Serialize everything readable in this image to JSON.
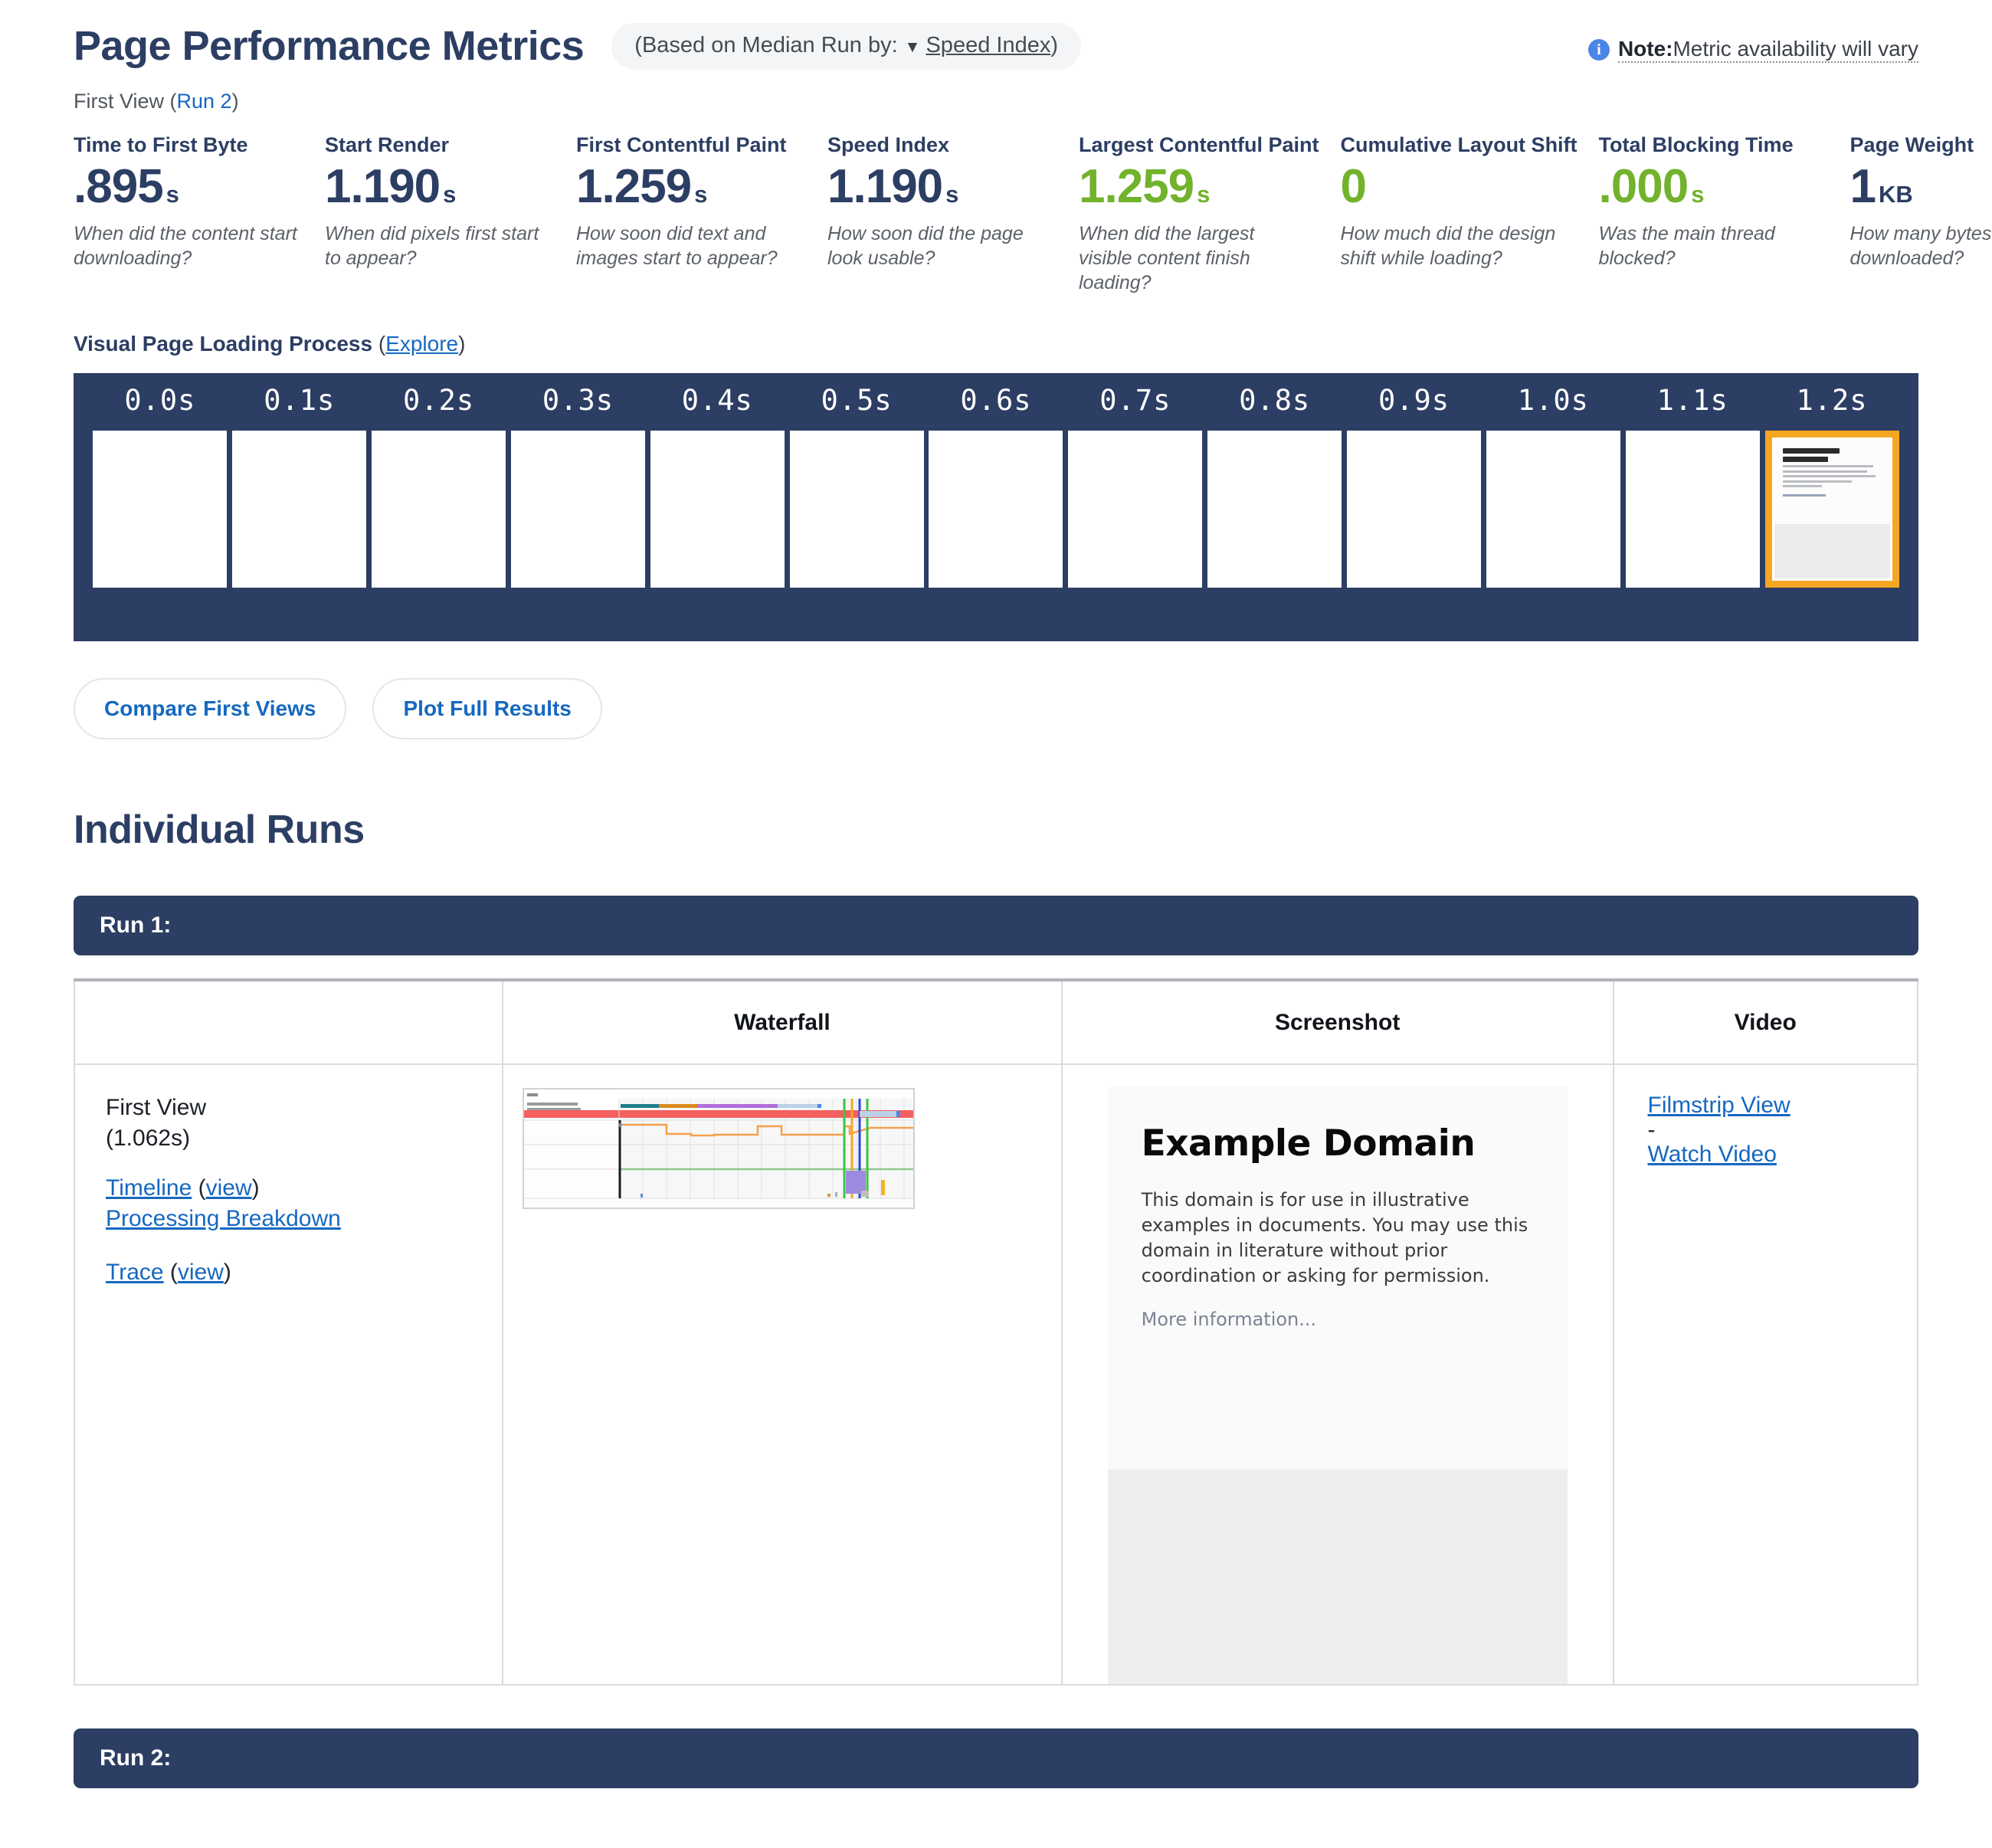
{
  "header": {
    "title": "Page Performance Metrics",
    "median_prefix": "(Based on Median Run by:",
    "median_caret": "▼",
    "median_selected": "Speed Index",
    "median_suffix": ")",
    "note_icon": "info-icon",
    "note_bold": "Note:",
    "note_text": " Metric availability will vary",
    "first_view_prefix": "First View (",
    "first_view_run": "Run 2",
    "first_view_suffix": ")"
  },
  "colors": {
    "navy": "#2c3e63",
    "green": "#72b22c",
    "link": "#1668c1",
    "highlight": "#f5a623"
  },
  "metrics": [
    {
      "label": "Time to First Byte",
      "value": ".895",
      "unit": "s",
      "color": "navy",
      "desc": "When did the content start downloading?"
    },
    {
      "label": "Start Render",
      "value": "1.190",
      "unit": "s",
      "color": "navy",
      "desc": "When did pixels first start to appear?"
    },
    {
      "label": "First Contentful Paint",
      "value": "1.259",
      "unit": "s",
      "color": "navy",
      "desc": "How soon did text and images start to appear?"
    },
    {
      "label": "Speed Index",
      "value": "1.190",
      "unit": "s",
      "color": "navy",
      "desc": "How soon did the page look usable?"
    },
    {
      "label": "Largest Contentful Paint",
      "value": "1.259",
      "unit": "s",
      "color": "green",
      "desc": "When did the largest visible content finish loading?"
    },
    {
      "label": "Cumulative Layout Shift",
      "value": "0",
      "unit": "",
      "color": "green",
      "desc": "How much did the design shift while loading?"
    },
    {
      "label": "Total Blocking Time",
      "value": ".000",
      "unit": "s",
      "color": "green",
      "desc": "Was the main thread blocked?"
    },
    {
      "label": "Page Weight",
      "value": "1",
      "unit": "KB",
      "color": "navy",
      "desc": "How many bytes downloaded?"
    }
  ],
  "visual_loading": {
    "title": "Visual Page Loading Process",
    "explore_label": "Explore",
    "frames": [
      {
        "time": "0.0s",
        "highlighted": false
      },
      {
        "time": "0.1s",
        "highlighted": false
      },
      {
        "time": "0.2s",
        "highlighted": false
      },
      {
        "time": "0.3s",
        "highlighted": false
      },
      {
        "time": "0.4s",
        "highlighted": false
      },
      {
        "time": "0.5s",
        "highlighted": false
      },
      {
        "time": "0.6s",
        "highlighted": false
      },
      {
        "time": "0.7s",
        "highlighted": false
      },
      {
        "time": "0.8s",
        "highlighted": false
      },
      {
        "time": "0.9s",
        "highlighted": false
      },
      {
        "time": "1.0s",
        "highlighted": false
      },
      {
        "time": "1.1s",
        "highlighted": false
      },
      {
        "time": "1.2s",
        "highlighted": true
      }
    ]
  },
  "buttons": {
    "compare_first_views": "Compare First Views",
    "plot_full_results": "Plot Full Results"
  },
  "individual_runs": {
    "section_title": "Individual Runs",
    "run1_label": "Run 1:",
    "run2_label": "Run 2:",
    "table_headers": {
      "info": "",
      "waterfall": "Waterfall",
      "screenshot": "Screenshot",
      "video": "Video"
    },
    "run1": {
      "view_name": "First View",
      "view_time": "(1.062s)",
      "timeline_label": "Timeline",
      "timeline_view": "view",
      "processing_breakdown": "Processing Breakdown",
      "trace_label": "Trace",
      "trace_view": "view",
      "filmstrip_view": "Filmstrip View",
      "separator": "-",
      "watch_video": "Watch Video",
      "screenshot": {
        "heading": "Example Domain",
        "body": "This domain is for use in illustrative examples in documents. You may use this domain in literature without prior coordination or asking for permission.",
        "more": "More information..."
      }
    }
  }
}
